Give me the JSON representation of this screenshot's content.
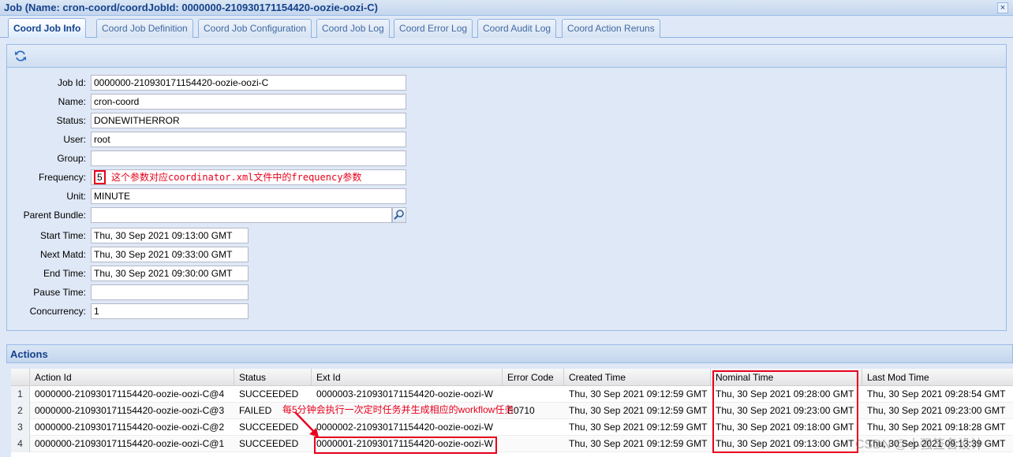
{
  "window": {
    "title": "Job (Name: cron-coord/coordJobId: 0000000-210930171154420-oozie-oozi-C)",
    "close_label": "×"
  },
  "tabs": [
    {
      "label": "Coord Job Info",
      "active": true
    },
    {
      "label": "Coord Job Definition"
    },
    {
      "label": "Coord Job Configuration"
    },
    {
      "label": "Coord Job Log"
    },
    {
      "label": "Coord Error Log"
    },
    {
      "label": "Coord Audit Log"
    },
    {
      "label": "Coord Action Reruns"
    }
  ],
  "toolbar": {
    "refresh_icon": "refresh-icon"
  },
  "form": {
    "job_id": {
      "label": "Job Id:",
      "value": "0000000-210930171154420-oozie-oozi-C"
    },
    "name": {
      "label": "Name:",
      "value": "cron-coord"
    },
    "status": {
      "label": "Status:",
      "value": "DONEWITHERROR"
    },
    "user": {
      "label": "User:",
      "value": "root"
    },
    "group": {
      "label": "Group:",
      "value": ""
    },
    "frequency": {
      "label": "Frequency:",
      "value": "5",
      "annotation": "这个参数对应coordinator.xml文件中的frequency参数"
    },
    "unit": {
      "label": "Unit:",
      "value": "MINUTE"
    },
    "parent_bundle": {
      "label": "Parent Bundle:",
      "value": ""
    },
    "start_time": {
      "label": "Start Time:",
      "value": "Thu, 30 Sep 2021 09:13:00 GMT"
    },
    "next_matd": {
      "label": "Next Matd:",
      "value": "Thu, 30 Sep 2021 09:33:00 GMT"
    },
    "end_time": {
      "label": "End Time:",
      "value": "Thu, 30 Sep 2021 09:30:00 GMT"
    },
    "pause_time": {
      "label": "Pause Time:",
      "value": ""
    },
    "concurrency": {
      "label": "Concurrency:",
      "value": "1"
    }
  },
  "actions": {
    "title": "Actions",
    "columns": [
      "Action Id",
      "Status",
      "Ext Id",
      "Error Code",
      "Created Time",
      "Nominal Time",
      "Last Mod Time"
    ],
    "rows": [
      {
        "num": "1",
        "action_id": "0000000-210930171154420-oozie-oozi-C@4",
        "status": "SUCCEEDED",
        "ext_id": "0000003-210930171154420-oozie-oozi-W",
        "error_code": "",
        "created": "Thu, 30 Sep 2021 09:12:59 GMT",
        "nominal": "Thu, 30 Sep 2021 09:28:00 GMT",
        "last_mod": "Thu, 30 Sep 2021 09:28:54 GMT"
      },
      {
        "num": "2",
        "action_id": "0000000-210930171154420-oozie-oozi-C@3",
        "status": "FAILED",
        "ext_id": "",
        "error_code": "E0710",
        "created": "Thu, 30 Sep 2021 09:12:59 GMT",
        "nominal": "Thu, 30 Sep 2021 09:23:00 GMT",
        "last_mod": "Thu, 30 Sep 2021 09:23:00 GMT"
      },
      {
        "num": "3",
        "action_id": "0000000-210930171154420-oozie-oozi-C@2",
        "status": "SUCCEEDED",
        "ext_id": "0000002-210930171154420-oozie-oozi-W",
        "error_code": "",
        "created": "Thu, 30 Sep 2021 09:12:59 GMT",
        "nominal": "Thu, 30 Sep 2021 09:18:00 GMT",
        "last_mod": "Thu, 30 Sep 2021 09:18:28 GMT"
      },
      {
        "num": "4",
        "action_id": "0000000-210930171154420-oozie-oozi-C@1",
        "status": "SUCCEEDED",
        "ext_id": "0000001-210930171154420-oozie-oozi-W",
        "error_code": "",
        "created": "Thu, 30 Sep 2021 09:12:59 GMT",
        "nominal": "Thu, 30 Sep 2021 09:13:00 GMT",
        "last_mod": "Thu, 30 Sep 2021 09:13:39 GMT"
      }
    ],
    "annotation": "每5分钟会执行一次定时任务并生成相应的workflow任务"
  },
  "watermark": "CSDN @小强签名设计",
  "colors": {
    "annotation_red": "#e8001c",
    "header_blue": "#15428b"
  }
}
